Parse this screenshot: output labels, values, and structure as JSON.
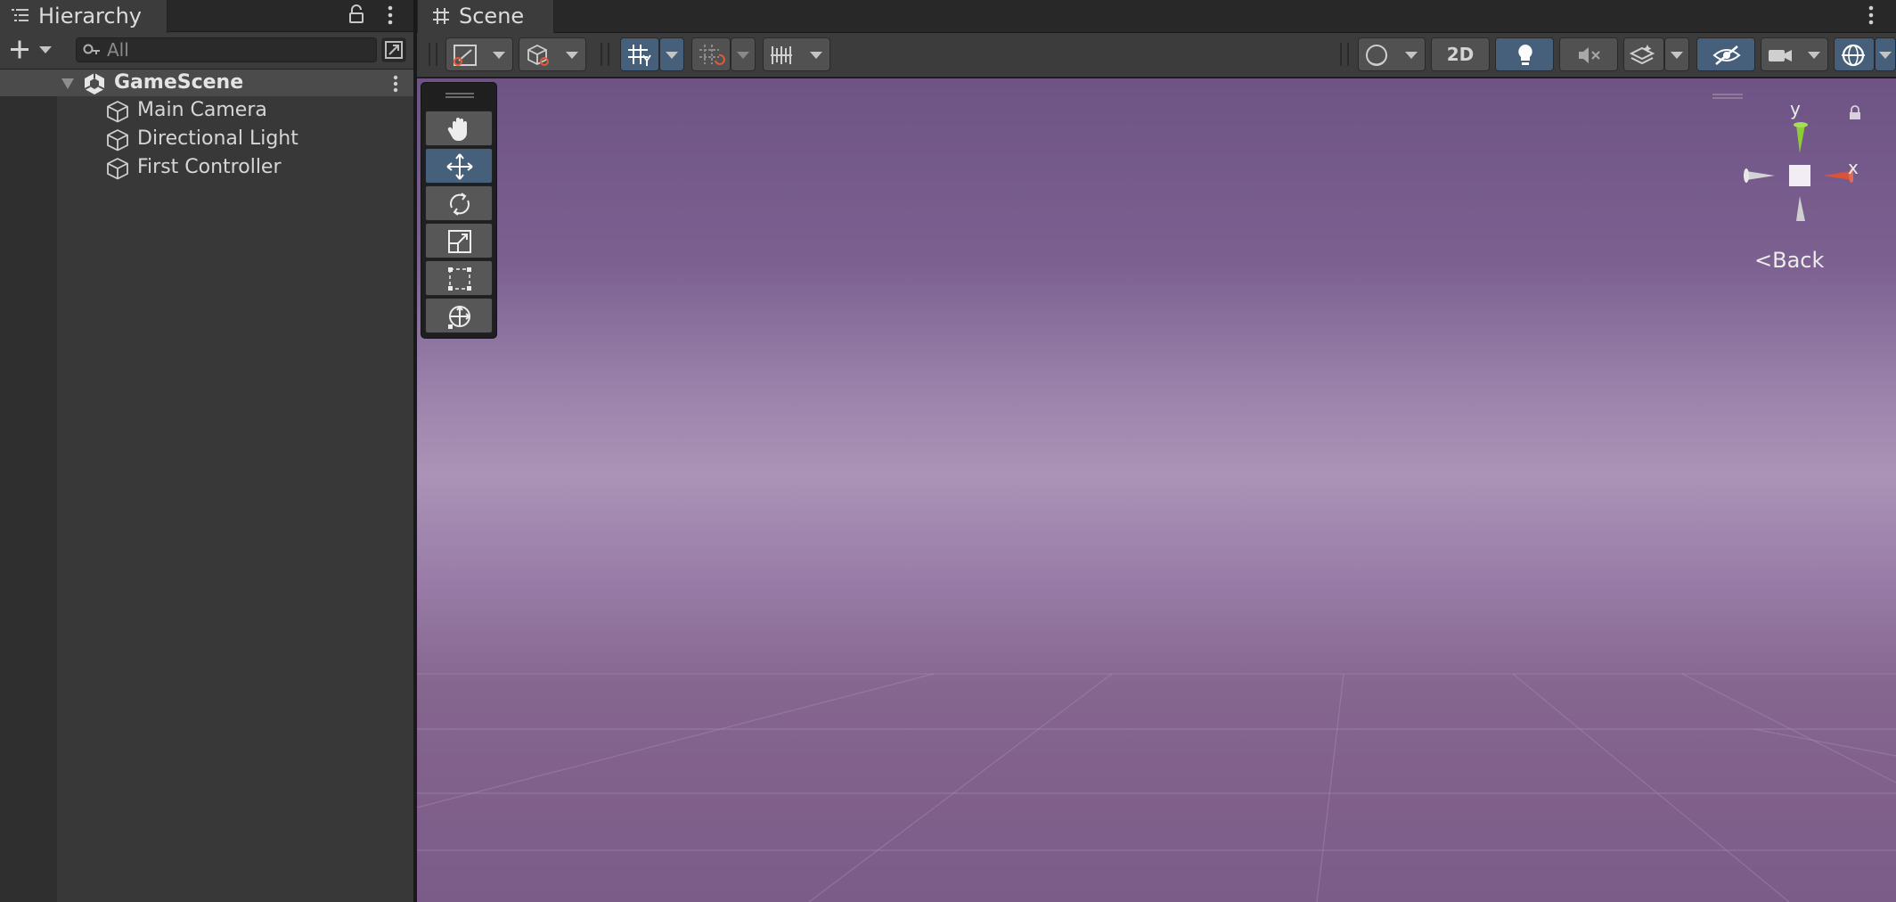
{
  "hierarchy": {
    "tab_title": "Hierarchy",
    "search_placeholder": "All",
    "scene": {
      "name": "GameScene"
    },
    "items": [
      {
        "label": "Main Camera"
      },
      {
        "label": "Directional Light"
      },
      {
        "label": "First Controller"
      }
    ]
  },
  "scene_view": {
    "tab_title": "Scene",
    "toolbar": {
      "mode_2d_label": "2D",
      "draw_mode": "shaded",
      "lighting_on": true,
      "grid_snapping_active": true
    },
    "tools": [
      {
        "name": "view-tool",
        "icon": "hand-icon",
        "active": false
      },
      {
        "name": "move-tool",
        "icon": "move-arrows-icon",
        "active": true
      },
      {
        "name": "rotate-tool",
        "icon": "rotate-icon",
        "active": false
      },
      {
        "name": "scale-tool",
        "icon": "scale-icon",
        "active": false
      },
      {
        "name": "rect-tool",
        "icon": "rect-transform-icon",
        "active": false
      },
      {
        "name": "transform-tool",
        "icon": "transform-icon",
        "active": false
      }
    ],
    "gizmo": {
      "axis_y": "y",
      "axis_x": "x",
      "view_label": "Back",
      "back_glyph": "<"
    }
  },
  "colors": {
    "panel_bg": "#383838",
    "toolbar_bg": "#3c3c3c",
    "active_blue": "#46607c",
    "gizmo_x": "#d9533a",
    "gizmo_y": "#8ecb37",
    "sky_top": "#6e5485",
    "horizon": "#ab93b6"
  }
}
